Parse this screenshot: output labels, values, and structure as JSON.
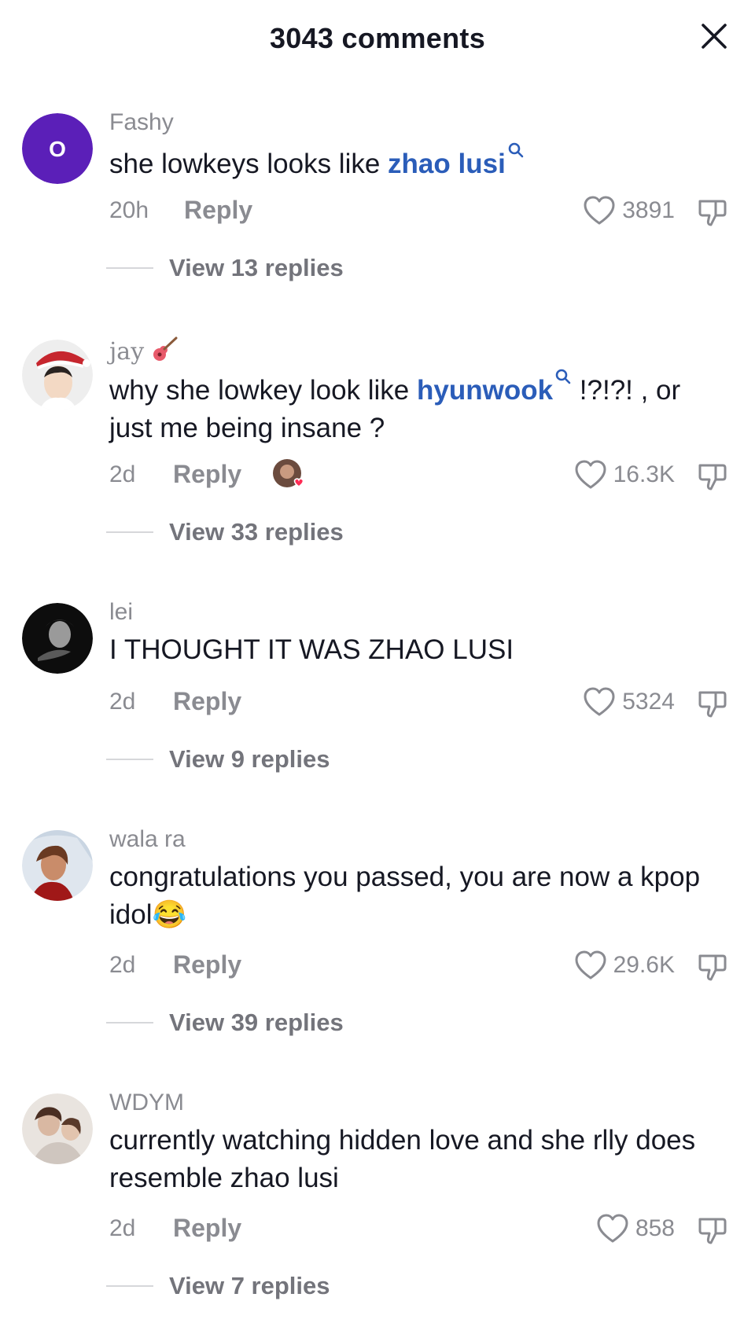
{
  "header": {
    "title": "3043 comments"
  },
  "colors": {
    "mention": "#2b5db9",
    "meta": "#8a8b91",
    "avatar_purple": "#5b1fb8"
  },
  "comments": [
    {
      "username": "Fashy",
      "avatar_letter": "O",
      "text_before": "she lowkeys looks like ",
      "mention": "zhao lusi",
      "time": "20h",
      "reply_label": "Reply",
      "likes": "3891",
      "view_replies": "View 13 replies"
    },
    {
      "username": "jay",
      "username_icon": "guitar-icon",
      "text_before": "why she lowkey look like ",
      "mention": "hyunwook",
      "text_after": " !?!?! , or just me being insane ?",
      "time": "2d",
      "reply_label": "Reply",
      "likes": "16.3K",
      "view_replies": "View 33 replies"
    },
    {
      "username": "lei",
      "text": "I THOUGHT IT WAS ZHAO LUSI",
      "time": "2d",
      "reply_label": "Reply",
      "likes": "5324",
      "view_replies": "View 9 replies"
    },
    {
      "username": "wala ra",
      "text": "congratulations you passed, you are now a kpop idol",
      "emoji": "😂",
      "time": "2d",
      "reply_label": "Reply",
      "likes": "29.6K",
      "view_replies": "View 39 replies"
    },
    {
      "username": "WDYM",
      "text": "currently watching hidden love and she rlly does resemble zhao lusi",
      "time": "2d",
      "reply_label": "Reply",
      "likes": "858",
      "view_replies": "View 7 replies"
    }
  ]
}
